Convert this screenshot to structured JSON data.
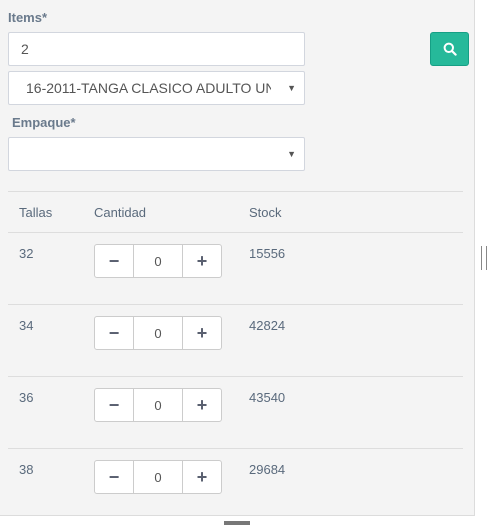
{
  "items": {
    "label": "Items*",
    "input_value": "2",
    "select_value": "16-2011-TANGA CLASICO ADULTO UN"
  },
  "search": {
    "icon": "search-icon"
  },
  "empaque": {
    "label": "Empaque*",
    "select_value": ""
  },
  "table": {
    "headers": {
      "tallas": "Tallas",
      "cantidad": "Cantidad",
      "stock": "Stock"
    },
    "rows": [
      {
        "talla": "32",
        "cantidad": "0",
        "stock": "15556"
      },
      {
        "talla": "34",
        "cantidad": "0",
        "stock": "42824"
      },
      {
        "talla": "36",
        "cantidad": "0",
        "stock": "43540"
      },
      {
        "talla": "38",
        "cantidad": "0",
        "stock": "29684"
      }
    ],
    "minus": "−",
    "plus": "+"
  },
  "colors": {
    "accent": "#26b99a",
    "panel": "#f4f4f4"
  }
}
